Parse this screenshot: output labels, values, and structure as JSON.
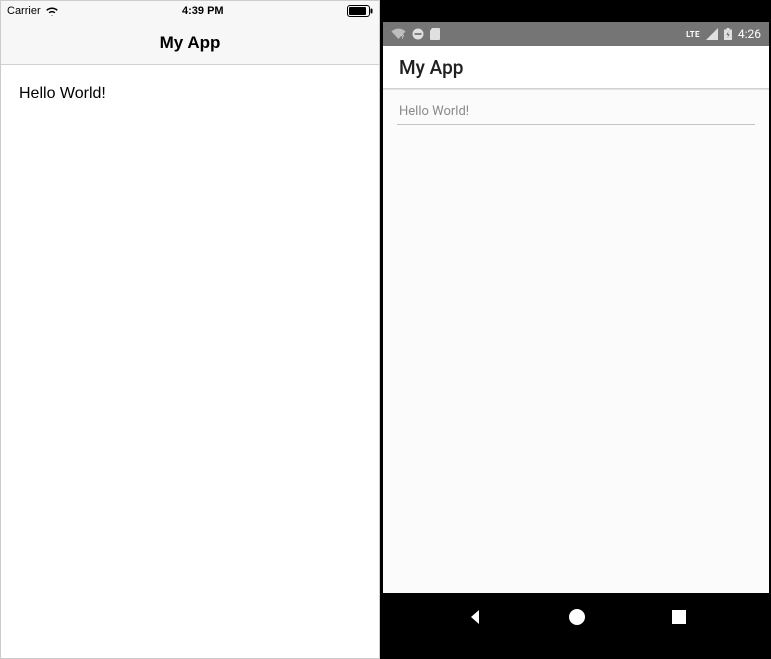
{
  "ios": {
    "statusbar": {
      "carrier": "Carrier",
      "time": "4:39 PM"
    },
    "navbar": {
      "title": "My App"
    },
    "content": {
      "input_value": "Hello World!"
    }
  },
  "android": {
    "statusbar": {
      "network_label": "LTE",
      "time": "4:26"
    },
    "toolbar": {
      "title": "My App"
    },
    "content": {
      "input_value": "Hello World!"
    }
  }
}
